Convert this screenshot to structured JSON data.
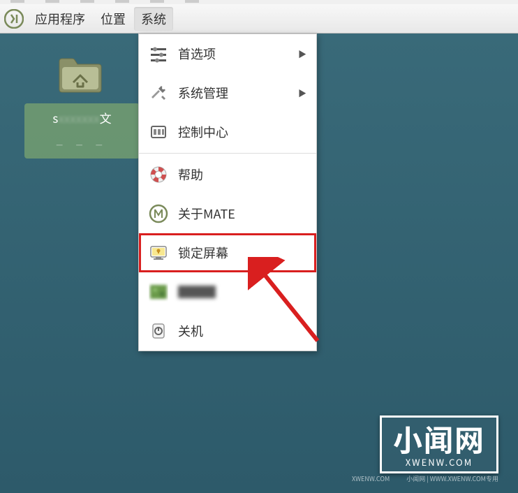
{
  "taskbar": {
    "applications": "应用程序",
    "places": "位置",
    "system": "系统"
  },
  "desktop": {
    "selected_label_prefix": "s",
    "selected_label_suffix": "文",
    "selected_sub": "— — —"
  },
  "menu": {
    "preferences": "首选项",
    "administration": "系统管理",
    "control_center": "控制中心",
    "help": "帮助",
    "about_mate": "关于MATE",
    "lock_screen": "锁定屏幕",
    "pixelated_item": "███",
    "shutdown": "关机"
  },
  "watermark": {
    "main": "小闻网",
    "sub": "XWENW.COM",
    "footer_left": "XWENW.COM",
    "footer_right": "小闻网 | WWW.XWENW.COM专用"
  }
}
